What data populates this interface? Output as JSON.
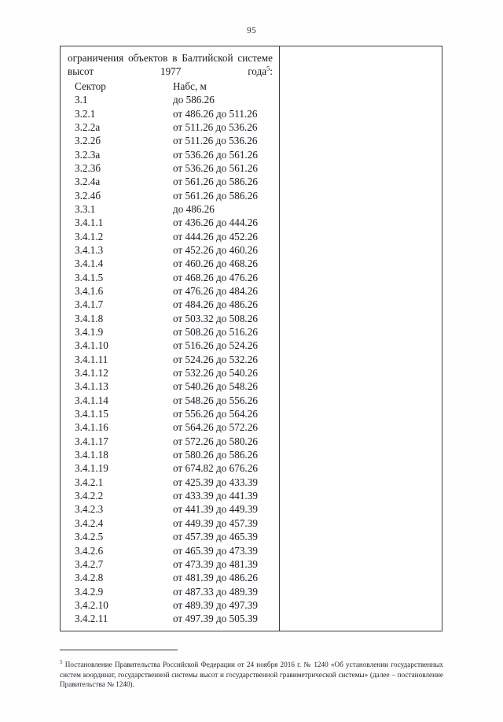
{
  "page": {
    "number": "95"
  },
  "table": {
    "intro_line1": "ограничения объектов в Балтийской",
    "intro_line2_prefix": "системе высот 1977 года",
    "intro_footnote_marker": "5",
    "intro_line2_suffix": ":",
    "headers": {
      "sector": "Сектор",
      "value": "Набс, м"
    },
    "rows": [
      {
        "sector": "3.1",
        "value": "до 586.26"
      },
      {
        "sector": "3.2.1",
        "value": "от 486.26 до 511.26"
      },
      {
        "sector": "3.2.2а",
        "value": "от 511.26 до 536.26"
      },
      {
        "sector": "3.2.2б",
        "value": "от 511.26 до 536.26"
      },
      {
        "sector": "3.2.3а",
        "value": "от 536.26 до 561.26"
      },
      {
        "sector": "3.2.3б",
        "value": "от 536.26 до 561.26"
      },
      {
        "sector": "3.2.4а",
        "value": "от 561.26 до 586.26"
      },
      {
        "sector": "3.2.4б",
        "value": "от 561.26 до 586.26"
      },
      {
        "sector": "3.3.1",
        "value": "до 486.26"
      },
      {
        "sector": "3.4.1.1",
        "value": "от 436.26 до 444.26"
      },
      {
        "sector": "3.4.1.2",
        "value": "от 444.26 до 452.26"
      },
      {
        "sector": "3.4.1.3",
        "value": "от 452.26 до 460.26"
      },
      {
        "sector": "3.4.1.4",
        "value": "от 460.26 до 468.26"
      },
      {
        "sector": "3.4.1.5",
        "value": "от 468.26 до 476.26"
      },
      {
        "sector": "3.4.1.6",
        "value": "от 476.26 до 484.26"
      },
      {
        "sector": "3.4.1.7",
        "value": "от 484.26 до 486.26"
      },
      {
        "sector": "3.4.1.8",
        "value": "от 503.32 до 508.26"
      },
      {
        "sector": "3.4.1.9",
        "value": "от 508.26 до 516.26"
      },
      {
        "sector": "3.4.1.10",
        "value": "от 516.26 до 524.26"
      },
      {
        "sector": "3.4.1.11",
        "value": "от 524.26 до 532.26"
      },
      {
        "sector": "3.4.1.12",
        "value": "от 532.26 до 540.26"
      },
      {
        "sector": "3.4.1.13",
        "value": "от 540.26 до 548.26"
      },
      {
        "sector": "3.4.1.14",
        "value": "от 548.26 до 556.26"
      },
      {
        "sector": "3.4.1.15",
        "value": "от 556.26 до 564.26"
      },
      {
        "sector": "3.4.1.16",
        "value": "от 564.26 до 572.26"
      },
      {
        "sector": "3.4.1.17",
        "value": "от 572.26 до 580.26"
      },
      {
        "sector": "3.4.1.18",
        "value": "от 580.26 до 586.26"
      },
      {
        "sector": "3.4.1.19",
        "value": "от 674.82 до 676.26"
      },
      {
        "sector": "3.4.2.1",
        "value": "от 425.39 до 433.39"
      },
      {
        "sector": "3.4.2.2",
        "value": "от 433.39 до 441.39"
      },
      {
        "sector": "3.4.2.3",
        "value": "от 441.39 до 449.39"
      },
      {
        "sector": "3.4.2.4",
        "value": "от 449.39 до 457.39"
      },
      {
        "sector": "3.4.2.5",
        "value": "от 457.39 до 465.39"
      },
      {
        "sector": "3.4.2.6",
        "value": "от 465.39 до 473.39"
      },
      {
        "sector": "3.4.2.7",
        "value": "от 473.39 до 481.39"
      },
      {
        "sector": "3.4.2.8",
        "value": "от 481.39 до 486.26"
      },
      {
        "sector": "3.4.2.9",
        "value": "от 487.33 до 489.39"
      },
      {
        "sector": "3.4.2.10",
        "value": "от 489.39 до 497.39"
      },
      {
        "sector": "3.4.2.11",
        "value": "от 497.39 до 505.39"
      }
    ]
  },
  "footnote": {
    "marker": "5",
    "text": "Постановление Правительства Российской Федерации от 24 ноября 2016 г. № 1240 «Об установлении государственных систем координат, государственной системы высот и государственной гравиметрической системы» (далее – постановление Правительства № 1240)."
  }
}
